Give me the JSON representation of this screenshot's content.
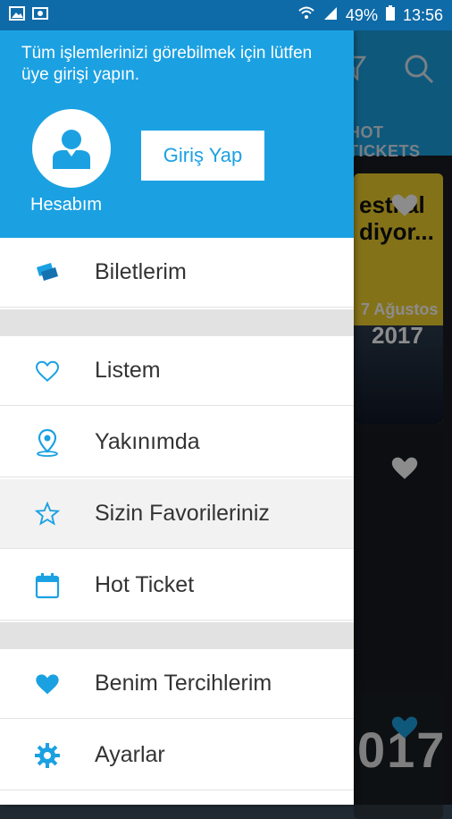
{
  "status_bar": {
    "battery": "49%",
    "time": "13:56"
  },
  "background": {
    "tab_label": "HOT TICKETS",
    "card1": {
      "poster_text": "esti al\ndiyor...",
      "date": "7 Ağustos",
      "year": "2017"
    },
    "card3_text": "017"
  },
  "drawer": {
    "login_message": "Tüm işlemlerinizi görebilmek için lütfen üye girişi yapın.",
    "account_label": "Hesabım",
    "login_button": "Giriş Yap",
    "menu": [
      {
        "label": "Biletlerim",
        "icon": "tickets-icon"
      },
      {
        "label": "Listem",
        "icon": "heart-outline-icon"
      },
      {
        "label": "Yakınımda",
        "icon": "location-pin-icon"
      },
      {
        "label": "Sizin Favorileriniz",
        "icon": "star-outline-icon"
      },
      {
        "label": "Hot Ticket",
        "icon": "calendar-icon"
      },
      {
        "label": "Benim Tercihlerim",
        "icon": "heart-filled-icon"
      },
      {
        "label": "Ayarlar",
        "icon": "gear-icon"
      }
    ]
  },
  "colors": {
    "accent": "#1ba1e2",
    "status_bar": "#0f6aa8",
    "icon": "#1ba1e2"
  }
}
